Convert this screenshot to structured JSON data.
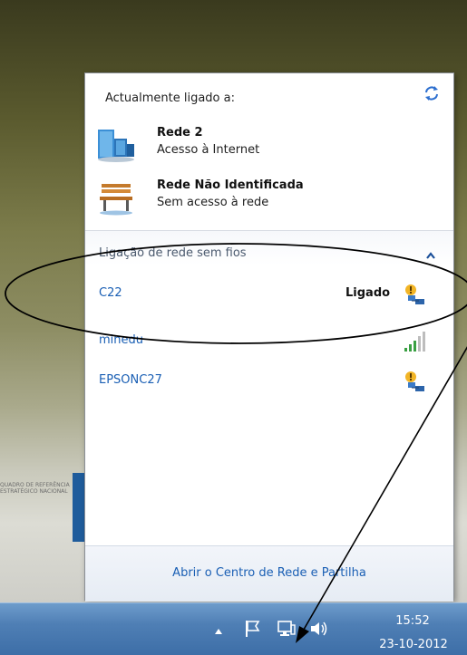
{
  "flyout": {
    "current_label": "Actualmente ligado a:",
    "connections": [
      {
        "name": "Rede  2",
        "status": "Acesso à Internet",
        "icon": "network-building-icon"
      },
      {
        "name": "Rede Não Identificada",
        "status": "Sem acesso à rede",
        "icon": "park-bench-icon"
      }
    ],
    "wireless_section_label": "Ligação de rede sem fios",
    "wireless_networks": [
      {
        "name": "C22",
        "status": "Ligado",
        "icon": "wireless-shield-icon"
      },
      {
        "name": "minedu",
        "status": "",
        "icon": "signal-bars-icon"
      },
      {
        "name": "EPSONC27",
        "status": "",
        "icon": "wireless-shield-icon"
      }
    ],
    "footer_link": "Abrir o Centro de Rede e Partilha"
  },
  "taskbar": {
    "time": "15:52",
    "date": "23-10-2012"
  },
  "wallpaper": {
    "text": "QUADRO DE REFERÊNCIA ESTRATÉGICO NACIONAL"
  },
  "colors": {
    "link": "#1a5fb4",
    "taskbar": "#4f7fb5"
  }
}
